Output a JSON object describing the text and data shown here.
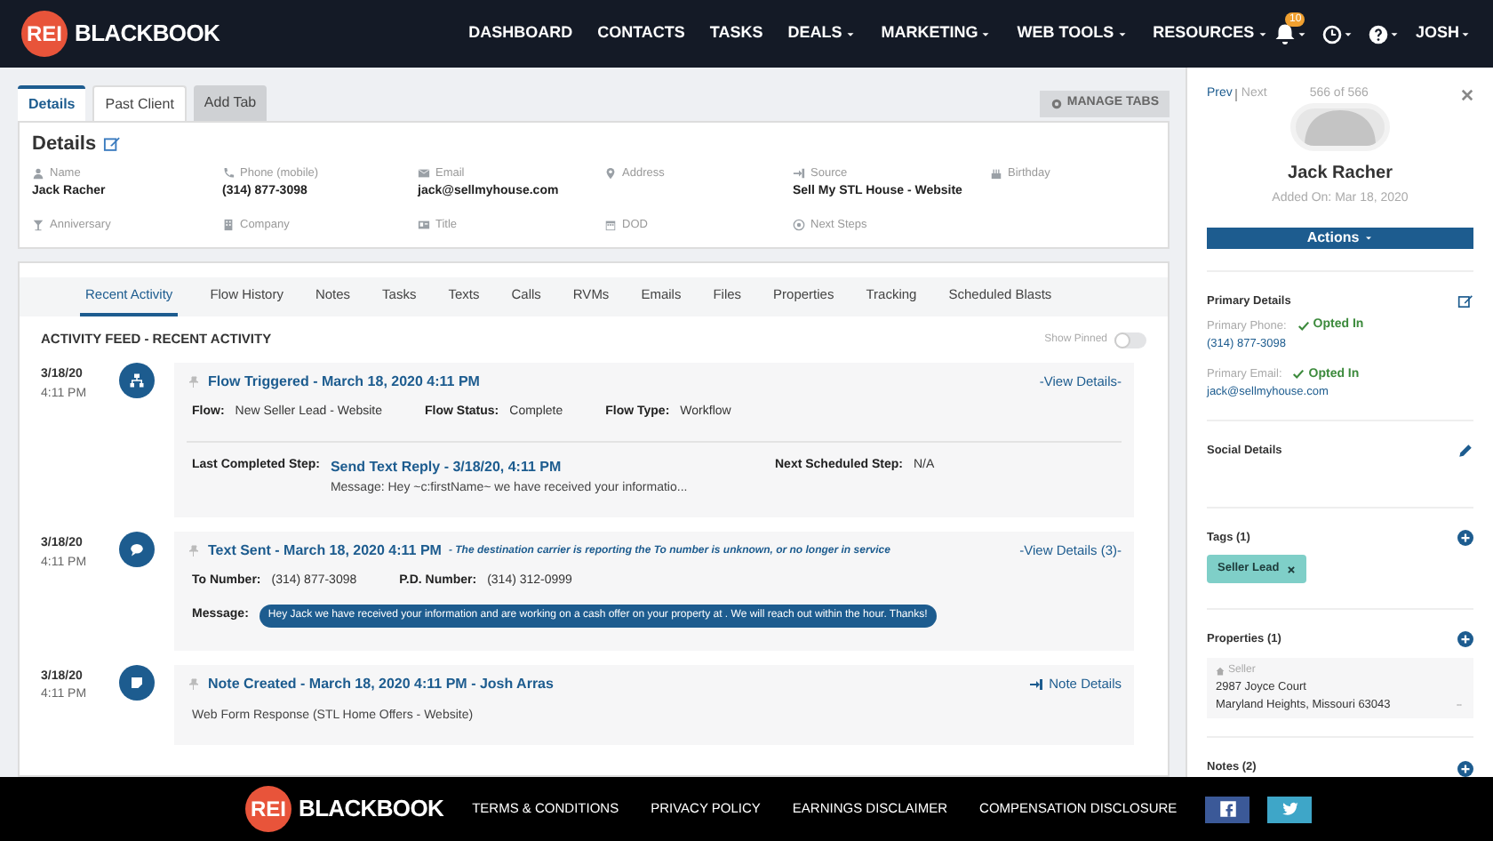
{
  "nav": {
    "logo": {
      "badge": "REI",
      "text": "BLACKBOOK"
    },
    "items": [
      {
        "label": "DASHBOARD",
        "dropdown": false
      },
      {
        "label": "CONTACTS",
        "dropdown": false
      },
      {
        "label": "TASKS",
        "dropdown": false
      },
      {
        "label": "DEALS",
        "dropdown": true
      },
      {
        "label": "MARKETING",
        "dropdown": true
      },
      {
        "label": "WEB TOOLS",
        "dropdown": true
      },
      {
        "label": "RESOURCES",
        "dropdown": true
      }
    ],
    "notification_count": "10",
    "user": "JOSH"
  },
  "detail_tabs": [
    {
      "label": "Details",
      "selected": true,
      "kind": "tab"
    },
    {
      "label": "Past Client",
      "selected": false,
      "kind": "tab"
    },
    {
      "label": "Add Tab",
      "selected": false,
      "kind": "add"
    }
  ],
  "manage_tabs": "MANAGE TABS",
  "details": {
    "title": "Details",
    "fields": [
      {
        "label": "Name",
        "value": "Jack Racher"
      },
      {
        "label": "Phone (mobile)",
        "value": "(314) 877-3098"
      },
      {
        "label": "Email",
        "value": "jack@sellmyhouse.com"
      },
      {
        "label": "Address"
      },
      {
        "label": "Source",
        "value": "Sell My STL House - Website"
      },
      {
        "label": "Birthday"
      },
      {
        "label": "Anniversary"
      },
      {
        "label": "Company"
      },
      {
        "label": "Title"
      },
      {
        "label": "DOD"
      },
      {
        "label": "Next Steps"
      }
    ]
  },
  "activity_tabs": [
    {
      "label": "Recent Activity",
      "selected": true
    },
    {
      "label": "Flow History",
      "selected": false
    },
    {
      "label": "Notes",
      "selected": false
    },
    {
      "label": "Tasks",
      "selected": false
    },
    {
      "label": "Texts",
      "selected": false
    },
    {
      "label": "Calls",
      "selected": false
    },
    {
      "label": "RVMs",
      "selected": false
    },
    {
      "label": "Emails",
      "selected": false
    },
    {
      "label": "Files",
      "selected": false
    },
    {
      "label": "Properties",
      "selected": false
    },
    {
      "label": "Tracking",
      "selected": false
    },
    {
      "label": "Scheduled Blasts",
      "selected": false
    }
  ],
  "feed": {
    "title": "ACTIVITY FEED - RECENT ACTIVITY",
    "show_pinned": {
      "label": "Show Pinned",
      "on": false
    },
    "entries": [
      {
        "kind": "flow",
        "date": "3/18/20",
        "time": "4:11 PM",
        "title": "Flow Triggered - March 18, 2020 4:11 PM",
        "link": "-View Details-",
        "fields": [
          {
            "label": "Flow:",
            "value": "New Seller Lead - Website"
          },
          {
            "label": "Flow Status:",
            "value": "Complete"
          },
          {
            "label": "Flow Type:",
            "value": "Workflow"
          }
        ],
        "last_step": {
          "label": "Last Completed Step:",
          "link": "Send Text Reply - 3/18/20, 4:11 PM",
          "message": "Message: Hey ~c:firstName~ we have received your informatio..."
        },
        "next_step": {
          "label": "Next Scheduled Step:",
          "value": "N/A"
        }
      },
      {
        "kind": "text",
        "date": "3/18/20",
        "time": "4:11 PM",
        "title": "Text Sent - March 18, 2020 4:11 PM",
        "note": "- The destination carrier is reporting the To number is unknown, or no longer in service",
        "link": "-View Details (3)-",
        "fields": [
          {
            "label": "To Number:",
            "value": "(314) 877-3098"
          },
          {
            "label": "P.D. Number:",
            "value": "(314) 312-0999"
          }
        ],
        "message_label": "Message:",
        "message": "Hey Jack we have received your information and are working on a cash offer on your property at . We will reach out within the hour. Thanks!"
      },
      {
        "kind": "note",
        "date": "3/18/20",
        "time": "4:11 PM",
        "title": "Note Created - March 18, 2020 4:11 PM - Josh Arras",
        "link": "Note Details",
        "body": "Web Form Response (STL Home Offers - Website)"
      }
    ]
  },
  "side": {
    "prev": "Prev",
    "next": "Next",
    "count": "566 of 566",
    "name": "Jack Racher",
    "added": "Added On: Mar 18, 2020",
    "actions": "Actions",
    "primary": {
      "title": "Primary Details",
      "items": [
        {
          "label": "Primary Phone:",
          "status": "Opted In",
          "value": "(314) 877-3098"
        },
        {
          "label": "Primary Email:",
          "status": "Opted In",
          "value": "jack@sellmyhouse.com"
        }
      ]
    },
    "social": {
      "title": "Social Details"
    },
    "tags": {
      "title": "Tags (1)",
      "items": [
        {
          "label": "Seller Lead",
          "color": "#7fcfc8"
        }
      ]
    },
    "properties": {
      "title": "Properties (1)",
      "items": [
        {
          "type": "Seller",
          "line1": "2987 Joyce Court",
          "line2": "Maryland Heights, Missouri 63043"
        }
      ]
    },
    "notes": {
      "title": "Notes (2)"
    }
  },
  "footer": {
    "logo": {
      "badge": "REI",
      "text": "BLACKBOOK"
    },
    "links": [
      "TERMS & CONDITIONS",
      "PRIVACY POLICY",
      "EARNINGS DISCLAIMER",
      "COMPENSATION DISCLOSURE"
    ]
  }
}
